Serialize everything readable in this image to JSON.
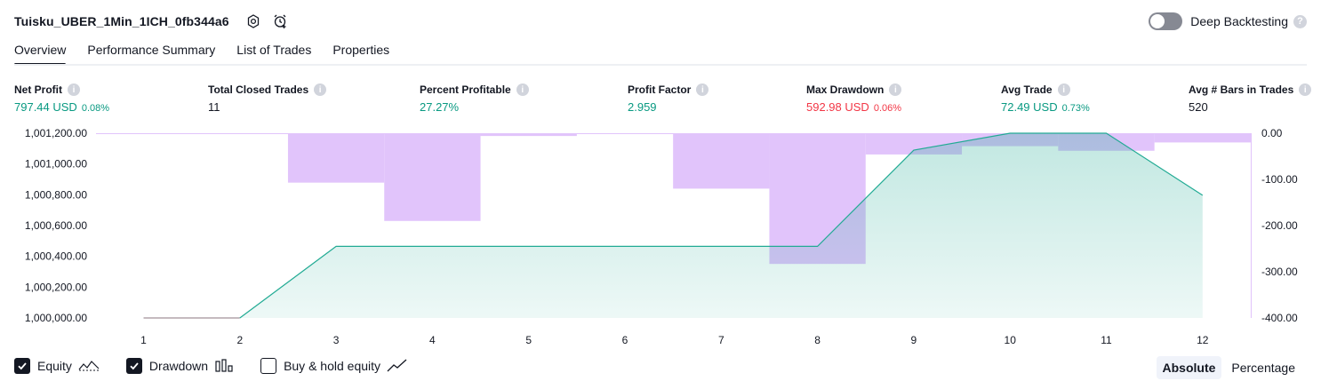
{
  "header": {
    "strategy_name": "Tuisku_UBER_1Min_1ICH_0fb344a6",
    "settings_icon": "settings-icon",
    "alert_icon": "add-alert-icon",
    "deep_backtesting_label": "Deep Backtesting",
    "deep_backtesting_enabled": false
  },
  "tabs": [
    {
      "label": "Overview",
      "active": true
    },
    {
      "label": "Performance Summary",
      "active": false
    },
    {
      "label": "List of Trades",
      "active": false
    },
    {
      "label": "Properties",
      "active": false
    }
  ],
  "metrics": [
    {
      "label": "Net Profit",
      "value": "797.44 USD",
      "pct": "0.08%",
      "color": "#089981"
    },
    {
      "label": "Total Closed Trades",
      "value": "11",
      "pct": "",
      "color": "#131722"
    },
    {
      "label": "Percent Profitable",
      "value": "27.27%",
      "pct": "",
      "color": "#089981"
    },
    {
      "label": "Profit Factor",
      "value": "2.959",
      "pct": "",
      "color": "#089981"
    },
    {
      "label": "Max Drawdown",
      "value": "592.98 USD",
      "pct": "0.06%",
      "color": "#f23645"
    },
    {
      "label": "Avg Trade",
      "value": "72.49 USD",
      "pct": "0.73%",
      "color": "#089981"
    },
    {
      "label": "Avg # Bars in Trades",
      "value": "520",
      "pct": "",
      "color": "#131722"
    }
  ],
  "chart_data": {
    "type": "area",
    "x": [
      1,
      2,
      3,
      4,
      5,
      6,
      7,
      8,
      9,
      10,
      11,
      12
    ],
    "x_tick_labels": [
      "1",
      "2",
      "3",
      "4",
      "5",
      "6",
      "7",
      "8",
      "9",
      "10",
      "11",
      "12"
    ],
    "left_axis": {
      "ylim": [
        1000000,
        1001200
      ],
      "tick_values": [
        1000000,
        1000200,
        1000400,
        1000600,
        1000800,
        1001000,
        1001200
      ],
      "tick_labels": [
        "1,000,000.00",
        "1,000,200.00",
        "1,000,400.00",
        "1,000,600.00",
        "1,000,800.00",
        "1,001,000.00",
        "1,001,200.00"
      ]
    },
    "right_axis": {
      "ylim": [
        -400,
        0
      ],
      "tick_values": [
        0,
        -100,
        -200,
        -300,
        -400
      ],
      "tick_labels": [
        "0.00",
        "-100.00",
        "-200.00",
        "-300.00",
        "-400.00"
      ]
    },
    "series": [
      {
        "name": "Equity",
        "axis": "left",
        "color": "#22ab94",
        "before_first_trade_color": "#b2a4aa",
        "points": [
          [
            1,
            1000000
          ],
          [
            2,
            1000000
          ],
          [
            3,
            1000465
          ],
          [
            8,
            1000465
          ],
          [
            9,
            1001090
          ],
          [
            10,
            1001200
          ],
          [
            11,
            1001200
          ],
          [
            12,
            1000797
          ]
        ]
      },
      {
        "name": "Drawdown",
        "axis": "right",
        "color": "#e1c4fb",
        "bars": [
          {
            "from": 2.5,
            "to": 3.5,
            "value": -107
          },
          {
            "from": 3.5,
            "to": 4.5,
            "value": -190
          },
          {
            "from": 4.5,
            "to": 5.5,
            "value": -6
          },
          {
            "from": 5.5,
            "to": 6.5,
            "value": 0
          },
          {
            "from": 6.5,
            "to": 7.5,
            "value": -120
          },
          {
            "from": 7.5,
            "to": 8.5,
            "value": -283
          },
          {
            "from": 8.5,
            "to": 9.5,
            "value": -46
          },
          {
            "from": 9.5,
            "to": 10.5,
            "value": -28
          },
          {
            "from": 10.5,
            "to": 11.5,
            "value": -38
          },
          {
            "from": 11.5,
            "to": 12.5,
            "value": -20
          },
          {
            "from": 12.5,
            "to": 13.5,
            "value": -400
          }
        ]
      }
    ]
  },
  "legend": [
    {
      "label": "Equity",
      "checked": true,
      "icon": "equity-line-icon"
    },
    {
      "label": "Drawdown",
      "checked": true,
      "icon": "drawdown-bars-icon"
    },
    {
      "label": "Buy & hold equity",
      "checked": false,
      "icon": "buy-hold-line-icon"
    }
  ],
  "modes": [
    {
      "label": "Absolute",
      "active": true
    },
    {
      "label": "Percentage",
      "active": false
    }
  ]
}
